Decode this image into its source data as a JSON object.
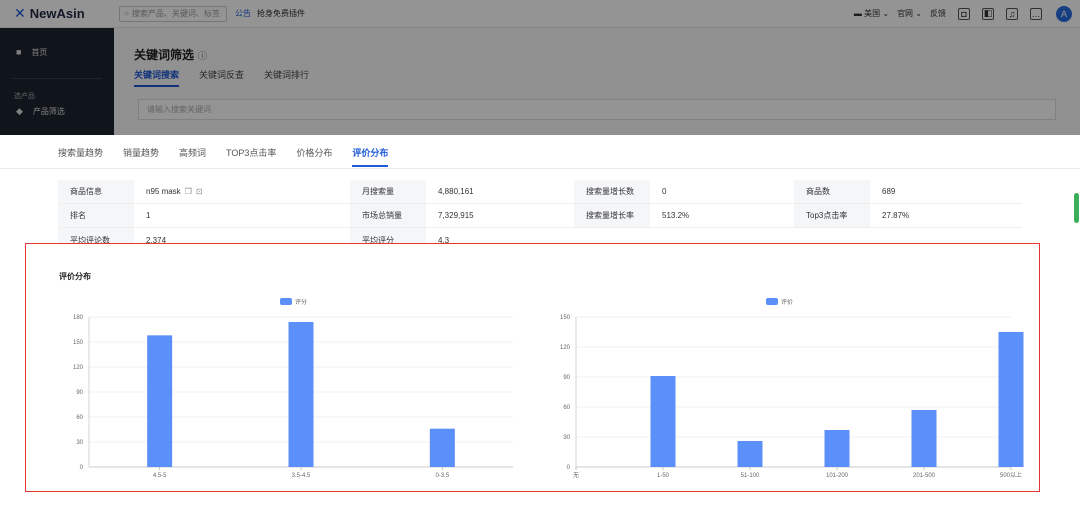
{
  "topbar": {
    "logo_mark": "✕",
    "logo_text": "NewAsin",
    "search_placeholder": "搜索产品、关键词、标签",
    "notice": "公告",
    "plugin": "抢身免费插件",
    "region": "美国",
    "site": "官网",
    "feedback": "反馈",
    "avatar_initial": "A"
  },
  "sidebar": {
    "home": "首页",
    "group": "选产品",
    "product_filter": "产品筛选"
  },
  "background_page": {
    "title": "关键词筛选",
    "tabs": [
      "关键词搜索",
      "关键词反查",
      "关键词排行"
    ],
    "input_placeholder": "请输入搜索关键词"
  },
  "subtabs": [
    {
      "label": "搜索量趋势",
      "active": false
    },
    {
      "label": "销量趋势",
      "active": false
    },
    {
      "label": "高频词",
      "active": false
    },
    {
      "label": "TOP3点击率",
      "active": false
    },
    {
      "label": "价格分布",
      "active": false
    },
    {
      "label": "评价分布",
      "active": true
    }
  ],
  "stats": {
    "row1": {
      "product_info_label": "商品信息",
      "product_info_value": "n95 mask",
      "monthly_search_label": "月搜索量",
      "monthly_search_value": "4,880,161",
      "search_growth_label": "搜索量增长数",
      "search_growth_value": "0",
      "product_count_label": "商品数",
      "product_count_value": "689"
    },
    "row2": {
      "rank_label": "排名",
      "rank_value": "1",
      "market_sales_label": "市场总销量",
      "market_sales_value": "7,329,915",
      "growth_rate_label": "搜索量增长率",
      "growth_rate_value": "513.2%",
      "top3_label": "Top3点击率",
      "top3_value": "27.87%"
    },
    "row3": {
      "avg_reviews_label": "平均评论数",
      "avg_reviews_value": "2,374",
      "avg_rating_label": "平均评分",
      "avg_rating_value": "4.3"
    }
  },
  "panel": {
    "title": "评价分布"
  },
  "colors": {
    "accent": "#1f5bd8",
    "bar": "#5b8ff9",
    "highlight": "#e53535"
  },
  "chart_data": [
    {
      "type": "bar",
      "legend": "评分",
      "categories": [
        "4.5-5",
        "3.5-4.5",
        "0-3.5"
      ],
      "series": [
        {
          "name": "评分",
          "values": [
            158,
            174,
            46
          ]
        }
      ],
      "ylim": [
        0,
        180
      ],
      "yticks": [
        0,
        30,
        60,
        90,
        120,
        150,
        180
      ],
      "grid": true,
      "legend_position": "top-center"
    },
    {
      "type": "bar",
      "legend": "评价",
      "categories": [
        "无",
        "1-50",
        "51-100",
        "101-200",
        "201-500",
        "500以上"
      ],
      "series": [
        {
          "name": "评价",
          "values": [
            0,
            91,
            26,
            37,
            57,
            135
          ]
        }
      ],
      "ylim": [
        0,
        150
      ],
      "yticks": [
        0,
        30,
        60,
        90,
        120,
        150
      ],
      "grid": true,
      "legend_position": "top-center"
    }
  ]
}
